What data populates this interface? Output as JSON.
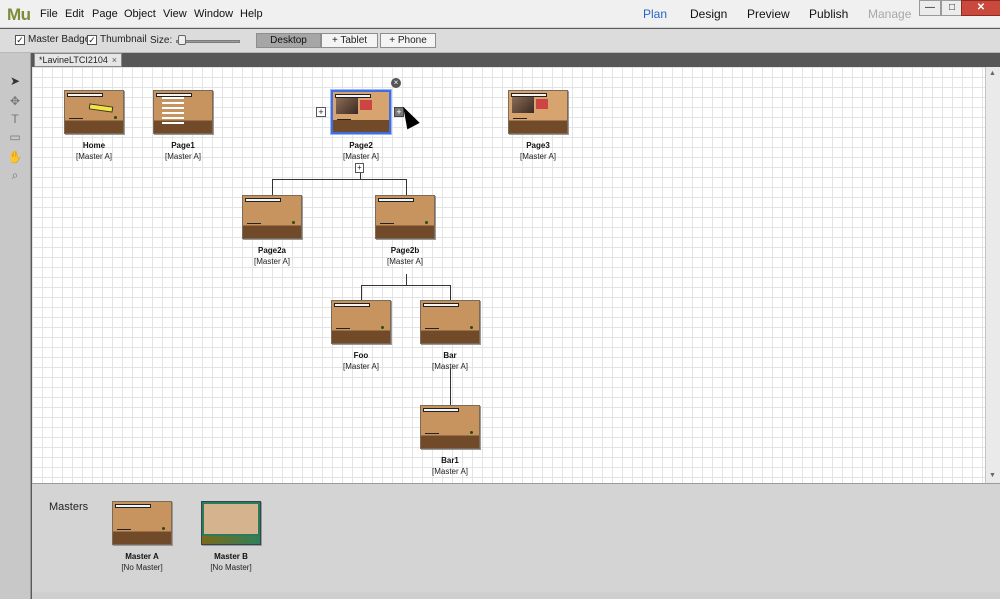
{
  "app": {
    "logo": "Mu",
    "menu": [
      "File",
      "Edit",
      "Page",
      "Object",
      "View",
      "Window",
      "Help"
    ],
    "modes": [
      "Plan",
      "Design",
      "Preview",
      "Publish",
      "Manage"
    ],
    "active_mode": "Plan",
    "window_buttons": [
      "—",
      "□",
      "✕"
    ]
  },
  "toolbar": {
    "master_badge": "Master Badge",
    "thumbnail": "Thumbnail",
    "size_label": "Size:",
    "size_value": 0.1,
    "views": [
      "Desktop",
      "+ Tablet",
      "+ Phone"
    ],
    "active_view": "Desktop"
  },
  "tab": {
    "title": "*LavineLTCI2104",
    "close": "×"
  },
  "pages": {
    "home": {
      "name": "Home",
      "master": "[Master A]"
    },
    "page1": {
      "name": "Page1",
      "master": "[Master A]"
    },
    "page2": {
      "name": "Page2",
      "master": "[Master A]"
    },
    "page3": {
      "name": "Page3",
      "master": "[Master A]"
    },
    "page2a": {
      "name": "Page2a",
      "master": "[Master A]"
    },
    "page2b": {
      "name": "Page2b",
      "master": "[Master A]"
    },
    "foo": {
      "name": "Foo",
      "master": "[Master A]"
    },
    "bar": {
      "name": "Bar",
      "master": "[Master A]"
    },
    "bar1": {
      "name": "Bar1",
      "master": "[Master A]"
    }
  },
  "masters": {
    "label": "Masters",
    "a": {
      "name": "Master A",
      "master": "[No Master]"
    },
    "b": {
      "name": "Master B",
      "master": "[No Master]"
    }
  },
  "handles": {
    "add": "+",
    "close": "×",
    "child": "+"
  },
  "colors": {
    "accent": "#2a64c8",
    "selection": "#3d6fe3",
    "thumb_body": "#c7945f",
    "thumb_footer": "#714a2a"
  }
}
